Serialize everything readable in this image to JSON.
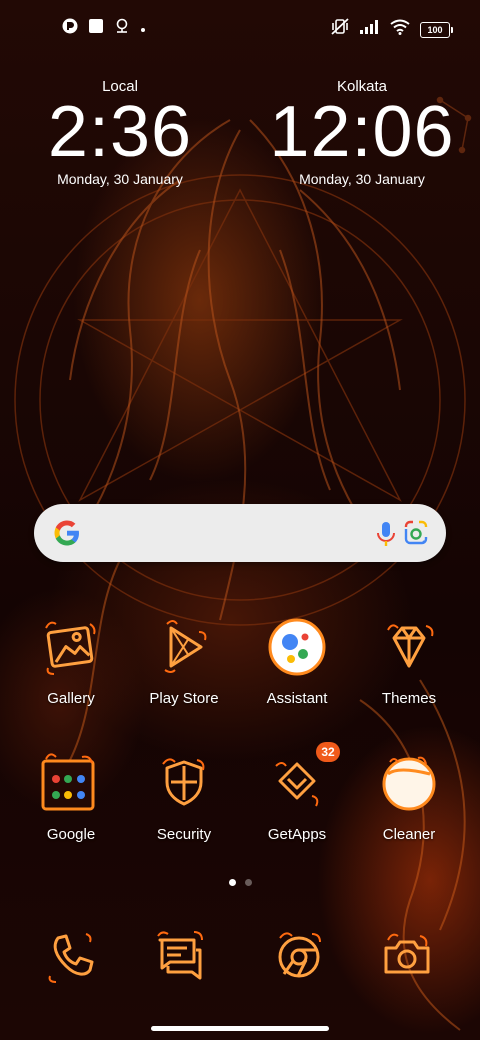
{
  "status_bar": {
    "battery": "100",
    "icons": [
      "app-notification-icon",
      "square-notification-icon",
      "location-icon",
      "dot-icon",
      "mute-vibrate-icon",
      "signal-icon",
      "wifi-icon",
      "battery-icon"
    ]
  },
  "clocks": [
    {
      "city": "Local",
      "time": "2:36",
      "date": "Monday, 30 January"
    },
    {
      "city": "Kolkata",
      "time": "12:06",
      "date": "Monday, 30 January"
    }
  ],
  "search": {
    "icons": [
      "google-logo-icon",
      "microphone-icon",
      "lens-camera-icon"
    ]
  },
  "apps": [
    {
      "label": "Gallery",
      "icon": "gallery-icon"
    },
    {
      "label": "Play Store",
      "icon": "play-store-icon"
    },
    {
      "label": "Assistant",
      "icon": "assistant-icon"
    },
    {
      "label": "Themes",
      "icon": "themes-diamond-icon"
    },
    {
      "label": "Google",
      "icon": "google-folder-icon"
    },
    {
      "label": "Security",
      "icon": "security-shield-icon"
    },
    {
      "label": "GetApps",
      "icon": "getapps-icon",
      "badge": "32"
    },
    {
      "label": "Cleaner",
      "icon": "cleaner-icon"
    }
  ],
  "dock": [
    {
      "icon": "phone-icon"
    },
    {
      "icon": "messages-icon"
    },
    {
      "icon": "chrome-icon"
    },
    {
      "icon": "camera-icon"
    }
  ],
  "pages": {
    "count": 2,
    "active": 1
  },
  "colors": {
    "accent": "#ff8a1e",
    "flame": "#ffb347",
    "badge": "#f05a1a",
    "background": "#1a0604"
  }
}
